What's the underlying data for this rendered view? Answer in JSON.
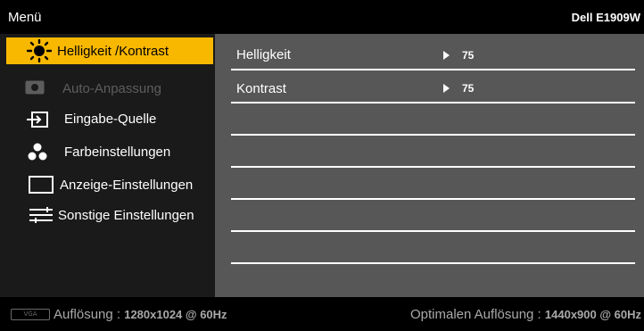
{
  "header": {
    "menu_title": "Menü",
    "model": "Dell E1909W"
  },
  "sidebar": {
    "items": [
      {
        "label": "Helligkeit /Kontrast",
        "icon": "brightness-icon",
        "state": "selected"
      },
      {
        "label": "Auto-Anpassung",
        "icon": "auto-adjust-icon",
        "state": "disabled"
      },
      {
        "label": "Eingabe-Quelle",
        "icon": "input-source-icon",
        "state": "normal"
      },
      {
        "label": "Farbeinstellungen",
        "icon": "color-settings-icon",
        "state": "normal"
      },
      {
        "label": "Anzeige-Einstellungen",
        "icon": "display-settings-icon",
        "state": "normal"
      },
      {
        "label": "Sonstige Einstellungen",
        "icon": "other-settings-icon",
        "state": "normal"
      }
    ]
  },
  "panel": {
    "rows": [
      {
        "label": "Helligkeit",
        "value": "75"
      },
      {
        "label": "Kontrast",
        "value": "75"
      }
    ]
  },
  "footer": {
    "res_icon_text": "VGA",
    "resolution_label": "Auflösung : ",
    "resolution_value": "1280x1024 @ 60Hz",
    "optimal_label": "Optimalen Auflösung : ",
    "optimal_value": "1440x900 @ 60Hz"
  },
  "colors": {
    "selected_bg": "#f9b800",
    "panel_bg": "#575757",
    "sidebar_bg": "#1a1a1a",
    "disabled_text": "#5d5d5d"
  }
}
